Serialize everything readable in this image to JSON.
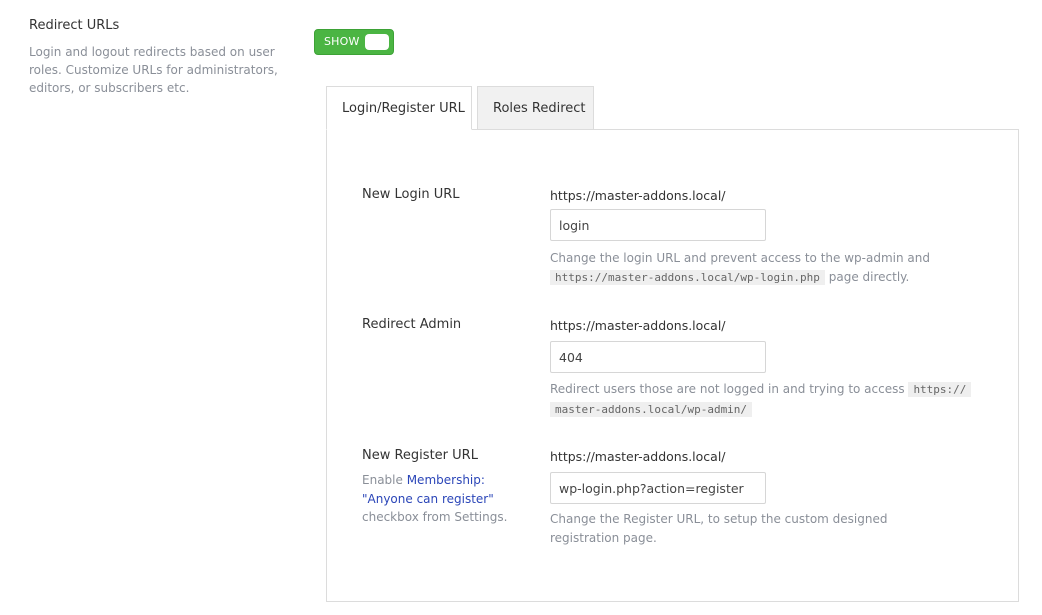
{
  "section": {
    "title": "Redirect URLs",
    "description": "Login and logout redirects based on user roles. Customize URLs for administrators, editors, or subscribers etc."
  },
  "toggle": {
    "label": "SHOW",
    "state": "on",
    "color": "#4bb543"
  },
  "tabs": [
    {
      "label": "Login/Register URL",
      "active": true
    },
    {
      "label": "Roles Redirect",
      "active": false
    }
  ],
  "fields": {
    "login": {
      "label": "New Login URL",
      "prefix": "https://master-addons.local/",
      "value": "login",
      "help_before": "Change the login URL and prevent access to the wp-admin and",
      "help_code": "https://master-addons.local/wp-login.php",
      "help_after": "page directly."
    },
    "admin": {
      "label": "Redirect Admin",
      "prefix": "https://master-addons.local/",
      "value": "404",
      "help_before": "Redirect users those are not logged in and trying to access",
      "help_code_1": "https://",
      "help_code_2": "master-addons.local/wp-admin/"
    },
    "register": {
      "label": "New Register URL",
      "note_before": "Enable",
      "note_link": "Membership: \"Anyone can register\"",
      "note_after": "checkbox from Settings.",
      "prefix": "https://master-addons.local/",
      "value": "wp-login.php?action=register",
      "help": "Change the Register URL, to setup the custom designed registration page."
    }
  }
}
